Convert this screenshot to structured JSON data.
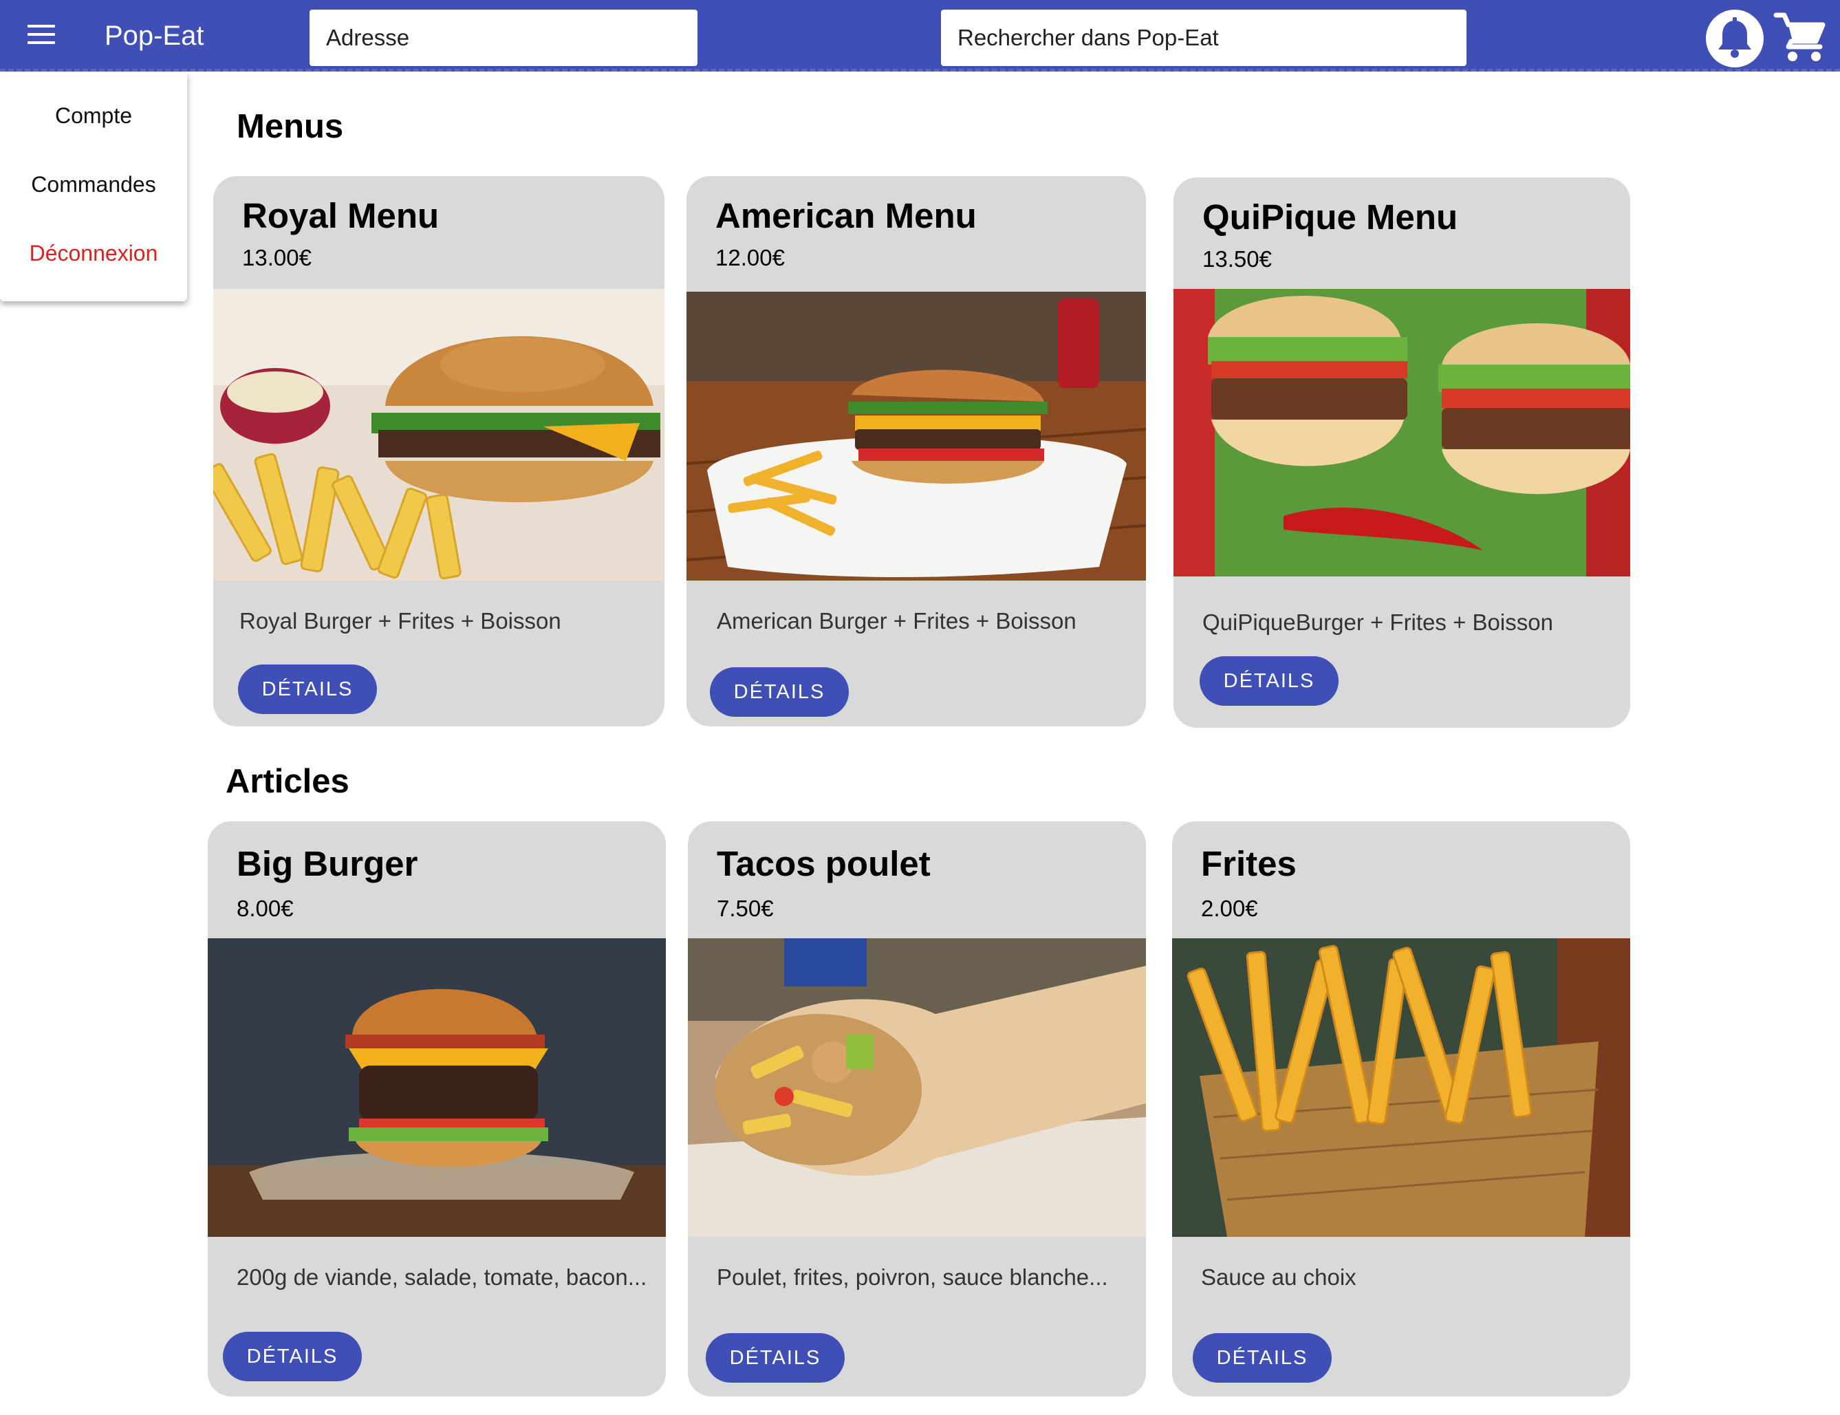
{
  "header": {
    "app_title": "Pop-Eat",
    "address_placeholder": "Adresse",
    "search_placeholder": "Rechercher dans Pop-Eat"
  },
  "dropdown": {
    "items": [
      {
        "label": "Compte"
      },
      {
        "label": "Commandes"
      },
      {
        "label": "Déconnexion"
      }
    ]
  },
  "colors": {
    "primary": "#3f4fb5",
    "card_bg": "#d9d9d9",
    "logout": "#e02020"
  },
  "menus": {
    "title": "Menus",
    "cards": [
      {
        "title": "Royal Menu",
        "price": "13.00€",
        "description": "Royal Burger + Frites + Boisson",
        "button": "DÉTAILS",
        "image": "burger-fries-photo"
      },
      {
        "title": "American Menu",
        "price": "12.00€",
        "description": "American Burger + Frites + Boisson",
        "button": "DÉTAILS",
        "image": "american-burger-plate-photo"
      },
      {
        "title": "QuiPique Menu",
        "price": "13.50€",
        "description": "QuiPiqueBurger + Frites + Boisson",
        "button": "DÉTAILS",
        "image": "two-burgers-chili-photo"
      }
    ]
  },
  "articles": {
    "title": "Articles",
    "cards": [
      {
        "title": "Big Burger",
        "price": "8.00€",
        "description": "200g de viande, salade, tomate, bacon...",
        "button": "DÉTAILS",
        "image": "big-burger-photo"
      },
      {
        "title": "Tacos poulet",
        "price": "7.50€",
        "description": "Poulet, frites, poivron, sauce blanche...",
        "button": "DÉTAILS",
        "image": "chicken-tacos-photo"
      },
      {
        "title": "Frites",
        "price": "2.00€",
        "description": "Sauce au choix",
        "button": "DÉTAILS",
        "image": "fries-basket-photo"
      }
    ]
  }
}
